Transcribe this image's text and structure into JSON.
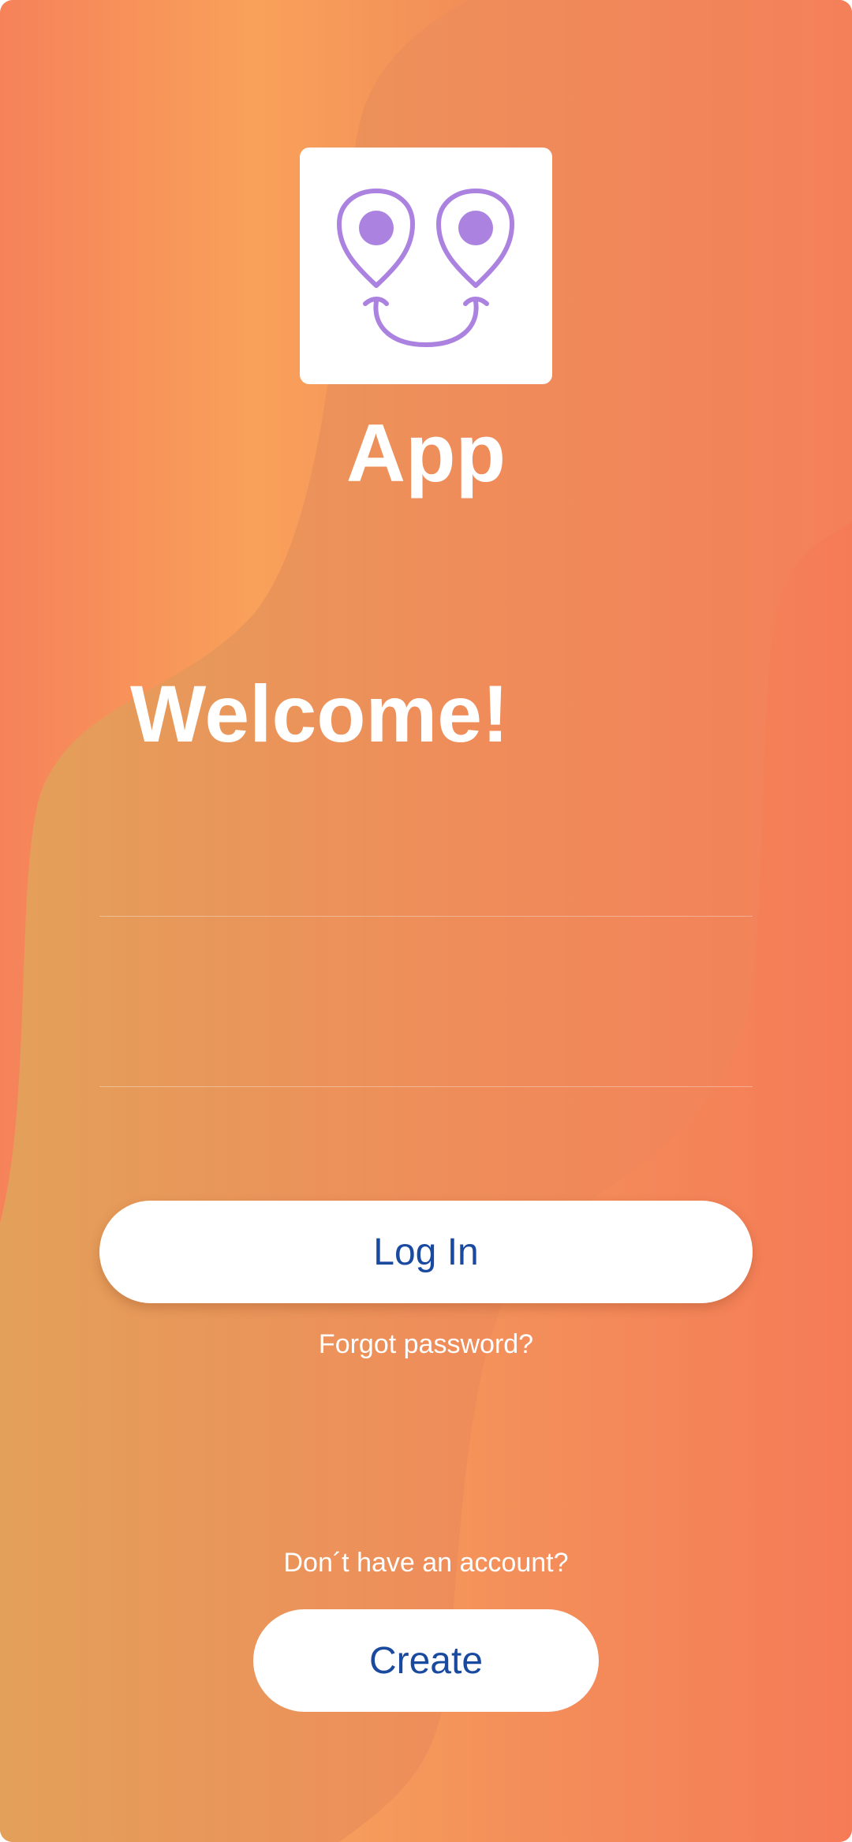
{
  "app": {
    "title": "App"
  },
  "welcome": {
    "heading": "Welcome!"
  },
  "form": {
    "email_value": "",
    "password_value": ""
  },
  "actions": {
    "login_label": "Log In",
    "forgot_label": "Forgot password?",
    "no_account_text": "Don´t have an account?",
    "create_label": "Create"
  },
  "colors": {
    "button_text": "#1a4aa0",
    "logo_purple": "#ab82e0",
    "background_orange": "#f6825a",
    "background_light": "#f9a15a"
  },
  "icons": {
    "logo": "smiling-location-pins-icon"
  }
}
